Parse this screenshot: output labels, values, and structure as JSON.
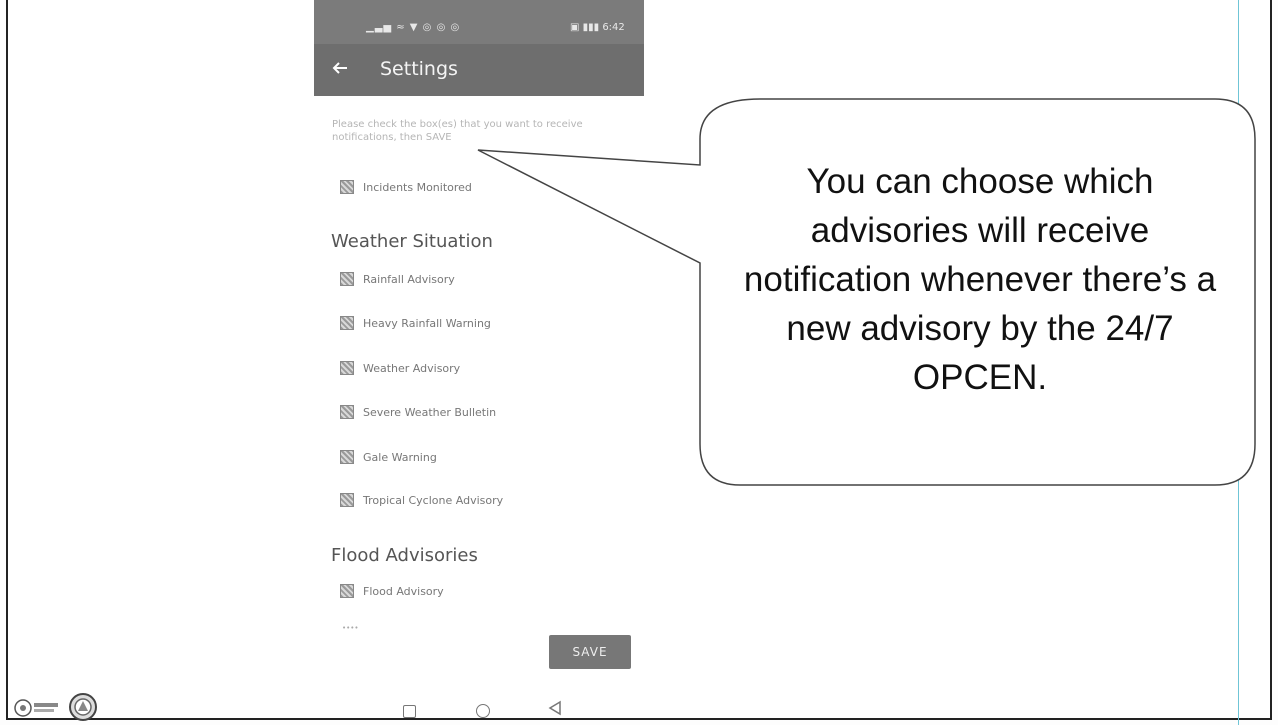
{
  "status_bar": {
    "left_icons": "▁▃▅ ≈ ▼ ◎ ◎ ◎",
    "right_text": "▣ ▮▮▮ 6:42"
  },
  "app_bar": {
    "back_icon": "arrow-left-icon",
    "title": "Settings"
  },
  "instructions": "Please check the box(es) that you want to receive notifications, then SAVE",
  "items": [
    {
      "label": "Incidents Monitored"
    },
    {
      "label": "Rainfall Advisory"
    },
    {
      "label": "Heavy Rainfall Warning"
    },
    {
      "label": "Weather Advisory"
    },
    {
      "label": "Severe Weather Bulletin"
    },
    {
      "label": "Gale Warning"
    },
    {
      "label": "Tropical Cyclone Advisory"
    },
    {
      "label": "Flood Advisory"
    }
  ],
  "sections": {
    "weather": "Weather Situation",
    "flood": "Flood Advisories"
  },
  "faded_item": "••••",
  "save_label": "SAVE",
  "callout": {
    "text": "You can choose which advisories will receive notification whenever there’s a new advisory by the 24/7 OPCEN."
  },
  "nav": [
    "square-icon",
    "circle-icon",
    "triangle-back-icon"
  ],
  "colors": {
    "app_bar": "#6e6e6e",
    "status_bar": "#7b7b7b",
    "save_button": "#777777",
    "guide_line": "#6fc5d6"
  }
}
